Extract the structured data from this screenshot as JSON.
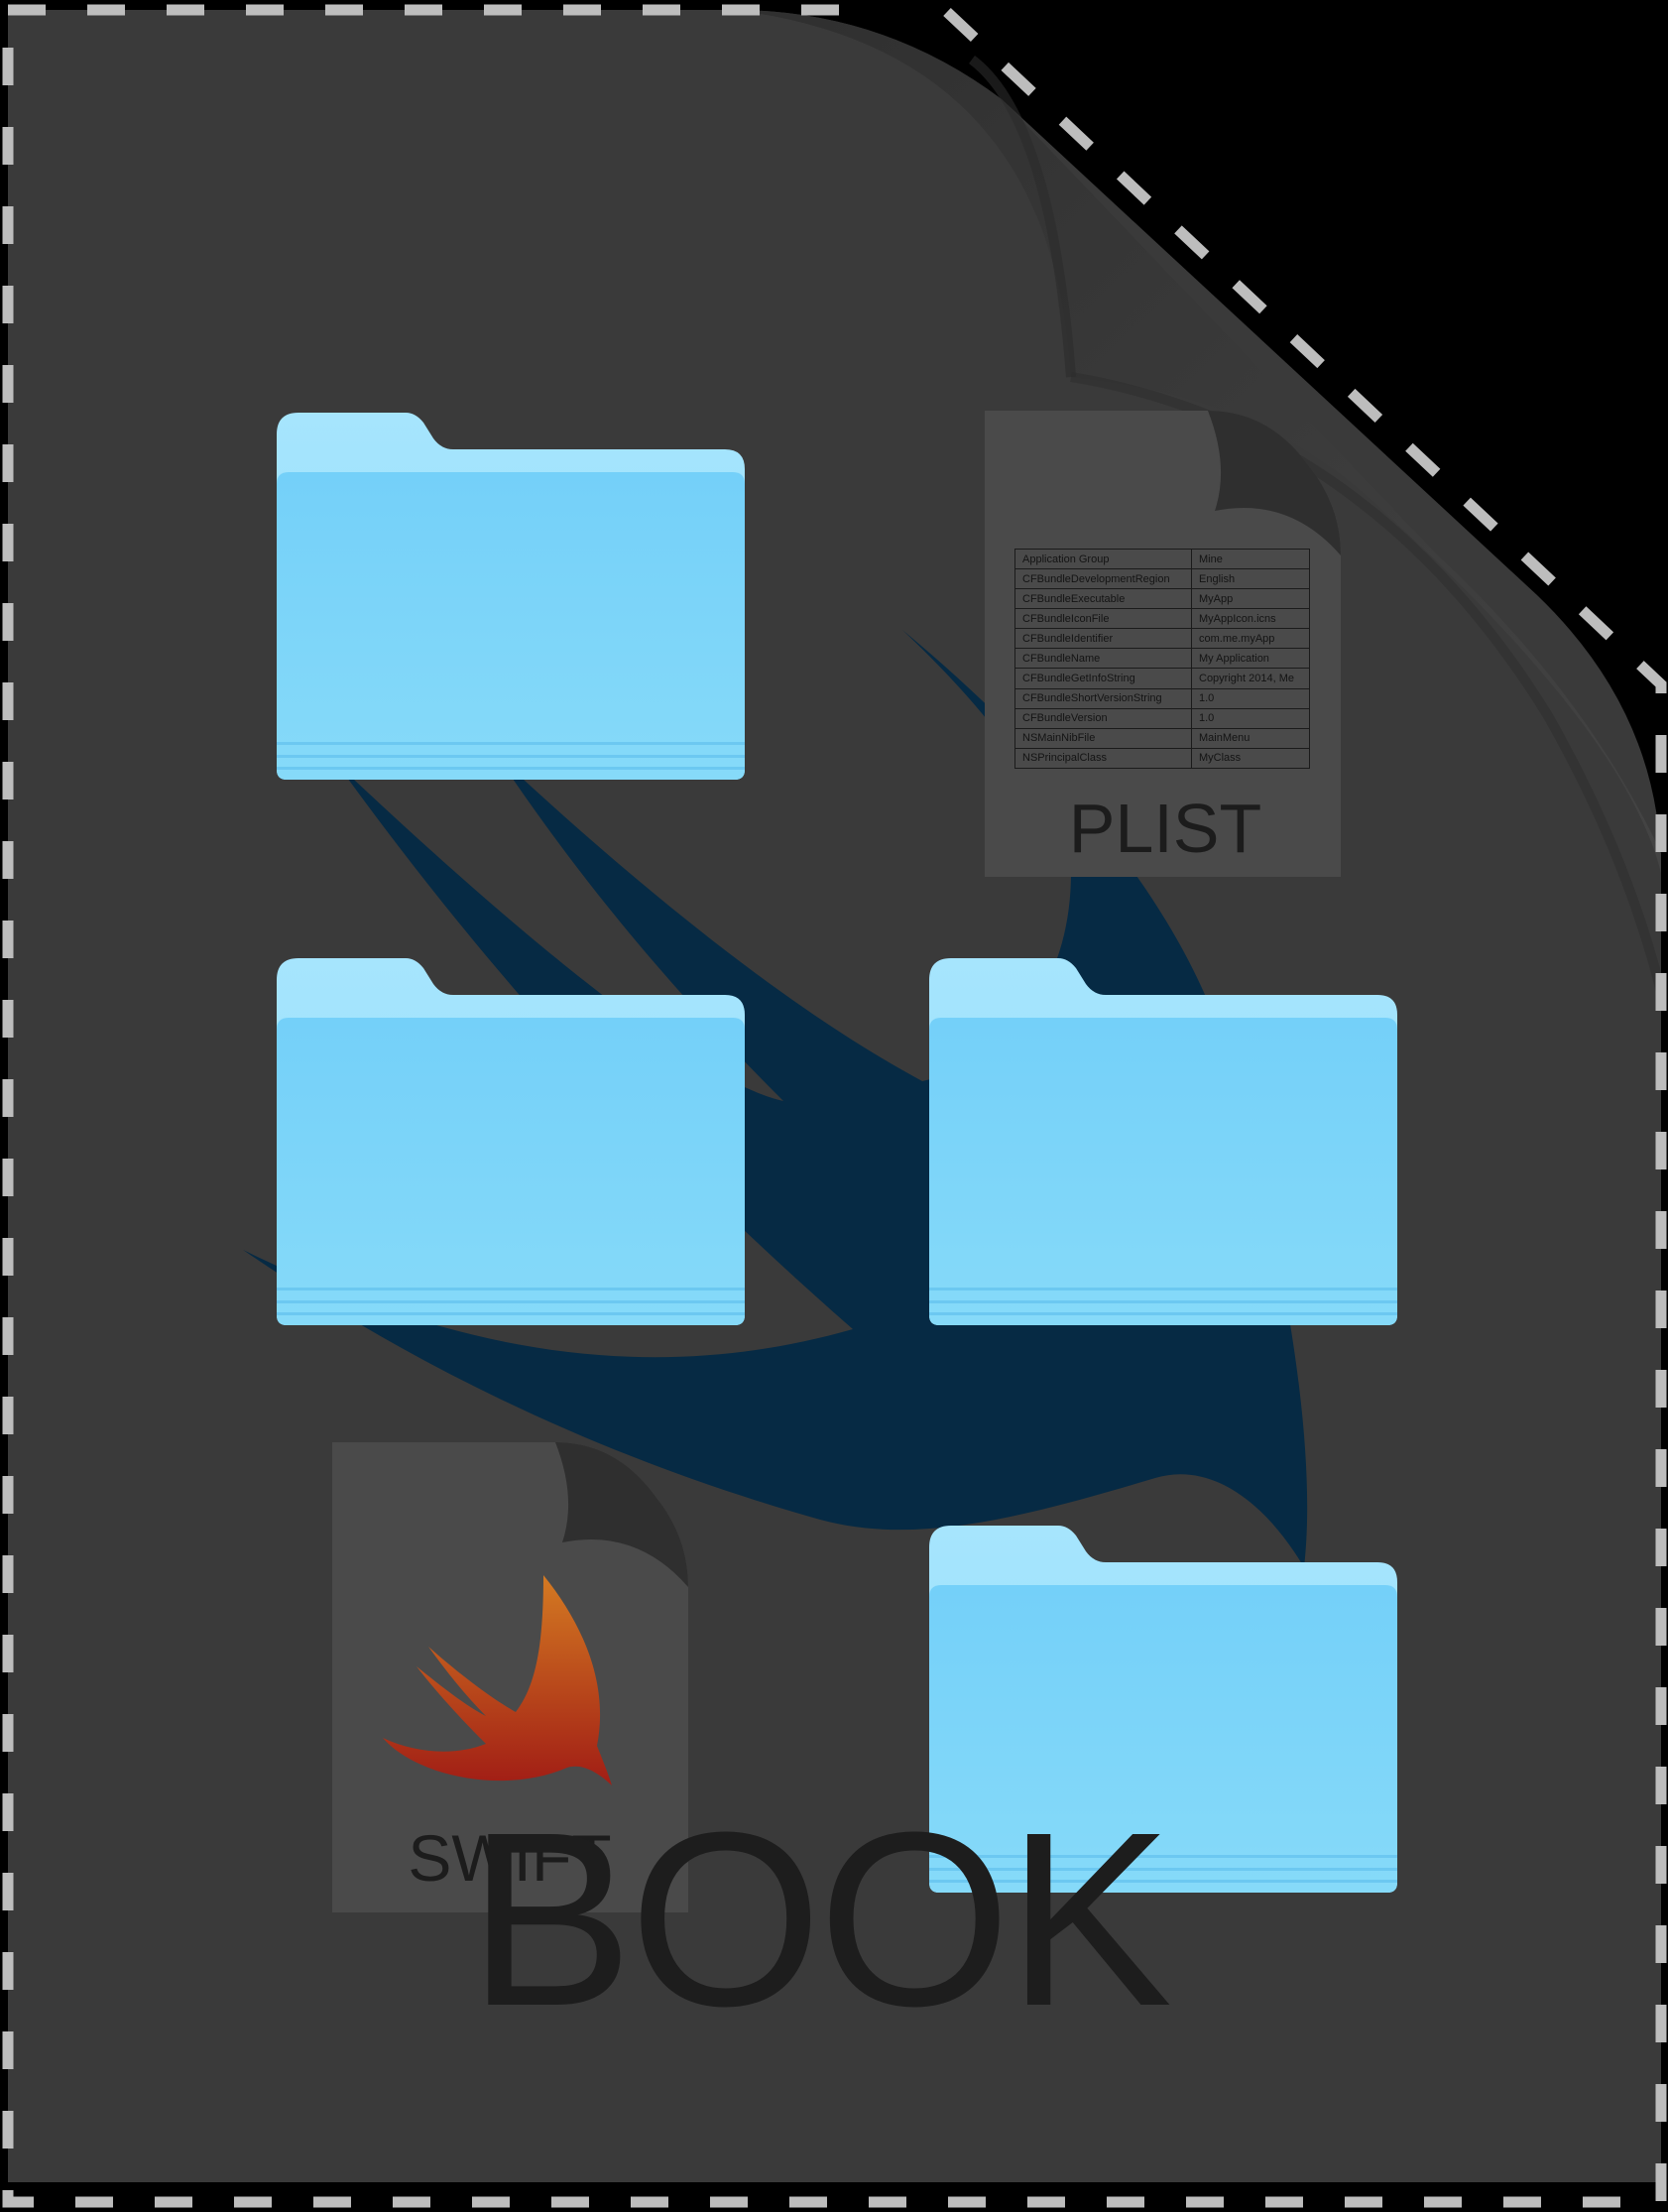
{
  "document_icon": {
    "name": "BOOK",
    "background_color": "#3a3a3a",
    "border_style": "dashed"
  },
  "plist_file": {
    "extension": "PLIST",
    "rows": [
      {
        "key": "Application Group",
        "value": "Mine"
      },
      {
        "key": "CFBundleDevelopmentRegion",
        "value": "English"
      },
      {
        "key": "CFBundleExecutable",
        "value": "MyApp"
      },
      {
        "key": "CFBundleIconFile",
        "value": "MyAppIcon.icns"
      },
      {
        "key": "CFBundleIdentifier",
        "value": "com.me.myApp"
      },
      {
        "key": "CFBundleName",
        "value": "My Application"
      },
      {
        "key": "CFBundleGetInfoString",
        "value": "Copyright 2014, Me"
      },
      {
        "key": "CFBundleShortVersionString",
        "value": "1.0"
      },
      {
        "key": "CFBundleVersion",
        "value": "1.0"
      },
      {
        "key": "NSMainNibFile",
        "value": "MainMenu"
      },
      {
        "key": "NSPrincipalClass",
        "value": "MyClass"
      }
    ]
  },
  "swift_file": {
    "extension": "SWIFT",
    "icon": "swift-bird-icon"
  },
  "folders": [
    {
      "icon": "folder-icon",
      "color": "#7cd3fa"
    },
    {
      "icon": "folder-icon",
      "color": "#7cd3fa"
    },
    {
      "icon": "folder-icon",
      "color": "#7cd3fa"
    },
    {
      "icon": "folder-icon",
      "color": "#7cd3fa"
    }
  ],
  "colors": {
    "folder_blue": "#7ad1f9",
    "folder_tab": "#a4e4fd",
    "watermark_navy": "#062a44",
    "swift_orange": "#c9691c",
    "swift_red": "#a42116"
  }
}
